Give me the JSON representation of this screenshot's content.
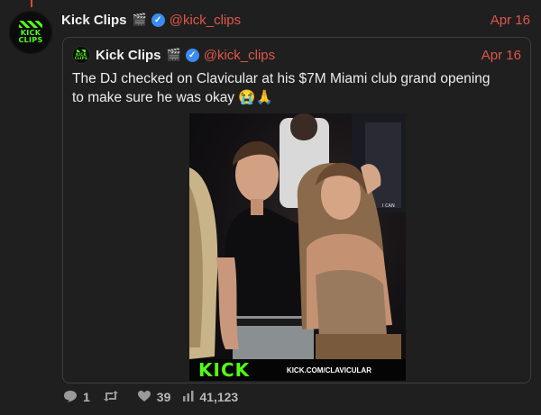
{
  "post": {
    "author_name": "Kick Clips",
    "author_emoji": "🎬",
    "handle": "@kick_clips",
    "date": "Apr 16",
    "avatar_text": "KICK CLIPS"
  },
  "quoted": {
    "author_name": "Kick Clips",
    "author_emoji": "🎬",
    "handle": "@kick_clips",
    "date": "Apr 16",
    "text": "The DJ checked on Clavicular at his $7M Miami club grand opening to make sure he was okay 😭🙏",
    "video": {
      "watermark_logo": "KICK",
      "watermark_url": "KICK.COM/CLAVICULAR",
      "background_sign": "I CAN"
    }
  },
  "actions": {
    "replies": "1",
    "reposts": "",
    "likes": "39",
    "views": "41,123"
  },
  "colors": {
    "background": "#1f1f1f",
    "accent_red": "#e0564b",
    "verified_blue": "#3a8cf0",
    "kick_green": "#53fc18"
  }
}
